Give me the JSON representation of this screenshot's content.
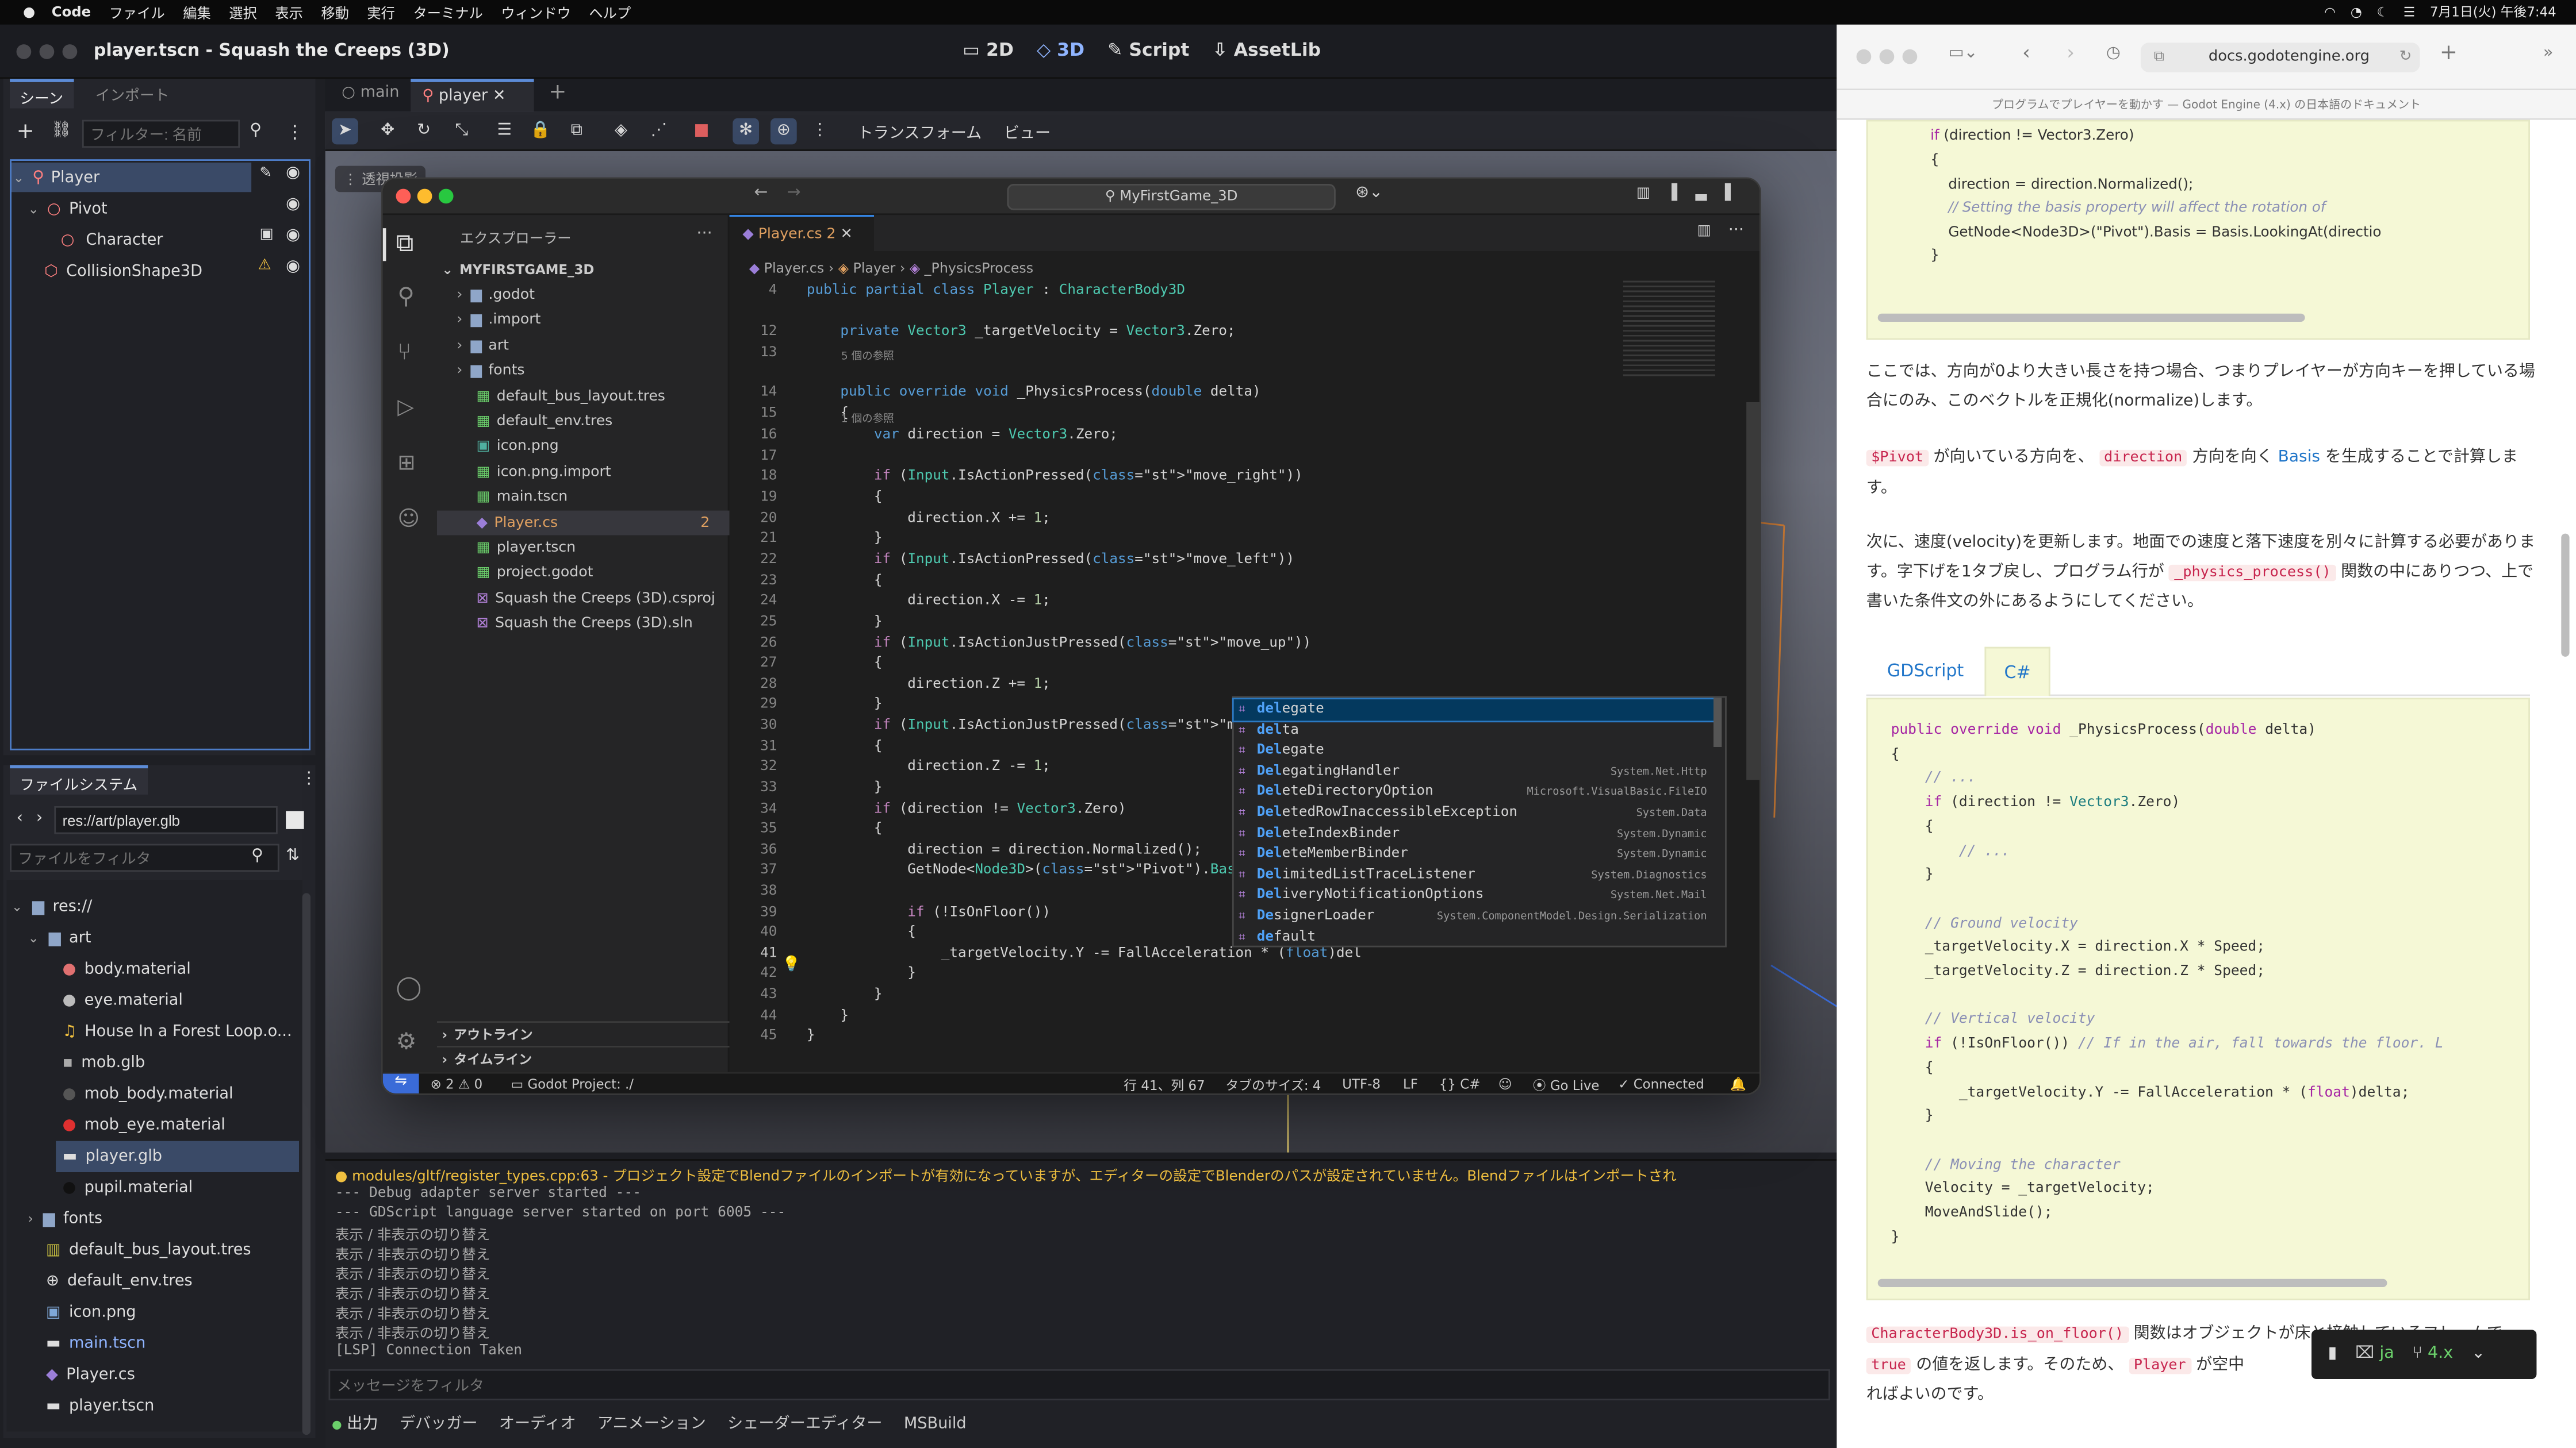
{
  "menubar": {
    "app": "Code",
    "items": [
      "ファイル",
      "編集",
      "選択",
      "表示",
      "移動",
      "実行",
      "ターミナル",
      "ウィンドウ",
      "ヘルプ"
    ],
    "clock": "7月1日(火) 午後7:44"
  },
  "godot": {
    "title": "player.tscn - Squash the Creeps (3D)",
    "modes": [
      "2D",
      "3D",
      "Script",
      "AssetLib"
    ],
    "scene_tabs": [
      "シーン",
      "インポート"
    ],
    "filter_placeholder": "フィルター: 名前",
    "scene_tree": [
      "Player",
      "Pivot",
      "Character",
      "CollisionShape3D"
    ],
    "doc_tabs": [
      "main",
      "player"
    ],
    "viewport_menus": [
      "トランスフォーム",
      "ビュー"
    ],
    "viewport_label": "透視投影",
    "fs_title": "ファイルシステム",
    "fs_path": "res://art/player.glb",
    "fs_filter": "ファイルをフィルタ",
    "fs_items": [
      "res://",
      "art",
      "body.material",
      "eye.material",
      "House In a Forest Loop.o...",
      "mob.glb",
      "mob_body.material",
      "mob_eye.material",
      "player.glb",
      "pupil.material",
      "fonts",
      "default_bus_layout.tres",
      "default_env.tres",
      "icon.png",
      "main.tscn",
      "Player.cs",
      "player.tscn"
    ],
    "output_lines": [
      "● modules/gltf/register_types.cpp:63 - プロジェクト設定でBlendファイルのインポートが有効になっていますが、エディターの設定でBlenderのパスが設定されていません。Blendファイルはインポートされ",
      "--- Debug adapter server started ---",
      "--- GDScript language server started on port 6005 ---",
      "表示 / 非表示の切り替え",
      "表示 / 非表示の切り替え",
      "表示 / 非表示の切り替え",
      "表示 / 非表示の切り替え",
      "表示 / 非表示の切り替え",
      "表示 / 非表示の切り替え",
      "[LSP] Connection Taken"
    ],
    "output_filter": "メッセージをフィルタ",
    "bottom_tabs": [
      "出力",
      "デバッガー",
      "オーディオ",
      "アニメーション",
      "シェーダーエディター",
      "MSBuild"
    ]
  },
  "vscode": {
    "search": "MyFirstGame_3D",
    "explorer_title": "エクスプローラー",
    "root": "MYFIRSTGAME_3D",
    "files": [
      ".godot",
      ".import",
      "art",
      "fonts",
      "default_bus_layout.tres",
      "default_env.tres",
      "icon.png",
      "icon.png.import",
      "main.tscn",
      "Player.cs",
      "player.tscn",
      "project.godot",
      "Squash the Creeps (3D).csproj",
      "Squash the Creeps (3D).sln"
    ],
    "player_badge": "2",
    "outline": "アウトライン",
    "timeline": "タイムライン",
    "tab": "Player.cs 2",
    "breadcrumb": [
      "Player.cs",
      "Player",
      "_PhysicsProcess"
    ],
    "ref5": "5 個の参照",
    "ref1": "1 個の参照",
    "code": [
      {
        "n": "4",
        "t": "public partial class Player : CharacterBody3D"
      },
      {
        "n": "12",
        "t": "    private Vector3 _targetVelocity = Vector3.Zero;"
      },
      {
        "n": "13",
        "t": ""
      },
      {
        "n": "14",
        "t": "    public override void _PhysicsProcess(double delta)"
      },
      {
        "n": "15",
        "t": "    {"
      },
      {
        "n": "16",
        "t": "        var direction = Vector3.Zero;"
      },
      {
        "n": "17",
        "t": ""
      },
      {
        "n": "18",
        "t": "        if (Input.IsActionPressed(\"move_right\"))"
      },
      {
        "n": "19",
        "t": "        {"
      },
      {
        "n": "20",
        "t": "            direction.X += 1;"
      },
      {
        "n": "21",
        "t": "        }"
      },
      {
        "n": "22",
        "t": "        if (Input.IsActionPressed(\"move_left\"))"
      },
      {
        "n": "23",
        "t": "        {"
      },
      {
        "n": "24",
        "t": "            direction.X -= 1;"
      },
      {
        "n": "25",
        "t": "        }"
      },
      {
        "n": "26",
        "t": "        if (Input.IsActionJustPressed(\"move_up\"))"
      },
      {
        "n": "27",
        "t": "        {"
      },
      {
        "n": "28",
        "t": "            direction.Z += 1;"
      },
      {
        "n": "29",
        "t": "        }"
      },
      {
        "n": "30",
        "t": "        if (Input.IsActionJustPressed(\"move_up\"))"
      },
      {
        "n": "31",
        "t": "        {"
      },
      {
        "n": "32",
        "t": "            direction.Z -= 1;"
      },
      {
        "n": "33",
        "t": "        }"
      },
      {
        "n": "34",
        "t": "        if (direction != Vector3.Zero)"
      },
      {
        "n": "35",
        "t": "        {"
      },
      {
        "n": "36",
        "t": "            direction = direction.Normalized();"
      },
      {
        "n": "37",
        "t": "            GetNode<Node3D>(\"Pivot\").Basis = Basis."
      },
      {
        "n": "38",
        "t": ""
      },
      {
        "n": "39",
        "t": "            if (!IsOnFloor())"
      },
      {
        "n": "40",
        "t": "            {"
      },
      {
        "n": "41",
        "t": "                _targetVelocity.Y -= FallAcceleration * (float)del"
      },
      {
        "n": "42",
        "t": "            }"
      },
      {
        "n": "43",
        "t": "        }"
      },
      {
        "n": "44",
        "t": "    }"
      },
      {
        "n": "45",
        "t": "}"
      }
    ],
    "suggestions": [
      {
        "a": "del",
        "b": "egate",
        "d": ""
      },
      {
        "a": "del",
        "b": "ta",
        "d": ""
      },
      {
        "a": "Del",
        "b": "egate",
        "d": ""
      },
      {
        "a": "Del",
        "b": "egatingHandler",
        "d": "System.Net.Http"
      },
      {
        "a": "Del",
        "b": "eteDirectoryOption",
        "d": "Microsoft.VisualBasic.FileIO"
      },
      {
        "a": "Del",
        "b": "etedRowInaccessibleException",
        "d": "System.Data"
      },
      {
        "a": "Del",
        "b": "eteIndexBinder",
        "d": "System.Dynamic"
      },
      {
        "a": "Del",
        "b": "eteMemberBinder",
        "d": "System.Dynamic"
      },
      {
        "a": "Del",
        "b": "imitedListTraceListener",
        "d": "System.Diagnostics"
      },
      {
        "a": "Del",
        "b": "iveryNotificationOptions",
        "d": "System.Net.Mail"
      },
      {
        "a": "De",
        "b": "signerLoader",
        "d": "System.ComponentModel.Design.Serialization"
      },
      {
        "a": "de",
        "b": "fault",
        "d": ""
      }
    ],
    "status": {
      "errors": "2",
      "warnings": "0",
      "project": "Godot Project: ./",
      "pos": "行 41、列 67",
      "tab": "タブのサイズ: 4",
      "enc": "UTF-8",
      "eol": "LF",
      "lang": "C#",
      "golive": "Go Live",
      "conn": "Connected"
    }
  },
  "browser": {
    "url": "docs.godotengine.org",
    "subtitle": "プログラムでプレイヤーを動かす — Godot Engine (4.x) の日本語のドキュメント",
    "code_top": [
      "if (direction != Vector3.Zero)",
      "{",
      "    direction = direction.Normalized();",
      "    // Setting the basis property will affect the rotation of",
      "    GetNode<Node3D>(\"Pivot\").Basis = Basis.LookingAt(directio",
      "}"
    ],
    "p1": "ここでは、方向が0より大きい長さを持つ場合、つまりプレイヤーが方向キーを押している場合にのみ、このベクトルを正規化(normalize)します。",
    "p2a": "$Pivot",
    "p2b": " が向いている方向を、 ",
    "p2c": "direction",
    "p2d": " 方向を向く ",
    "p2e": "Basis",
    "p2f": " を生成することで計算します。",
    "p3a": "次に、速度(velocity)を更新します。地面での速度と落下速度を別々に計算する必要があります。字下げを1タブ戻し、プログラム行が ",
    "p3b": "_physics_process()",
    "p3c": " 関数の中にありつつ、上で書いた条件文の外にあるようにしてください。",
    "tabs": [
      "GDScript",
      "C#"
    ],
    "code_main": [
      "public override void _PhysicsProcess(double delta)",
      "{",
      "    // ...",
      "    if (direction != Vector3.Zero)",
      "    {",
      "        // ...",
      "    }",
      "",
      "    // Ground velocity",
      "    _targetVelocity.X = direction.X * Speed;",
      "    _targetVelocity.Z = direction.Z * Speed;",
      "",
      "    // Vertical velocity",
      "    if (!IsOnFloor()) // If in the air, fall towards the floor. L",
      "    {",
      "        _targetVelocity.Y -= FallAcceleration * (float)delta;",
      "    }",
      "",
      "    // Moving the character",
      "    Velocity = _targetVelocity;",
      "    MoveAndSlide();",
      "}"
    ],
    "p4a": "CharacterBody3D.is_on_floor()",
    "p4b": " 関数はオブジェクトが床と接触しているフレームで ",
    "p4c": "true",
    "p4d": " の値を返します。そのため、 ",
    "p4e": "Player",
    "p4f": " が空中",
    "p4g": "ればよいのです。",
    "lang": "ja",
    "version": "4.x"
  }
}
